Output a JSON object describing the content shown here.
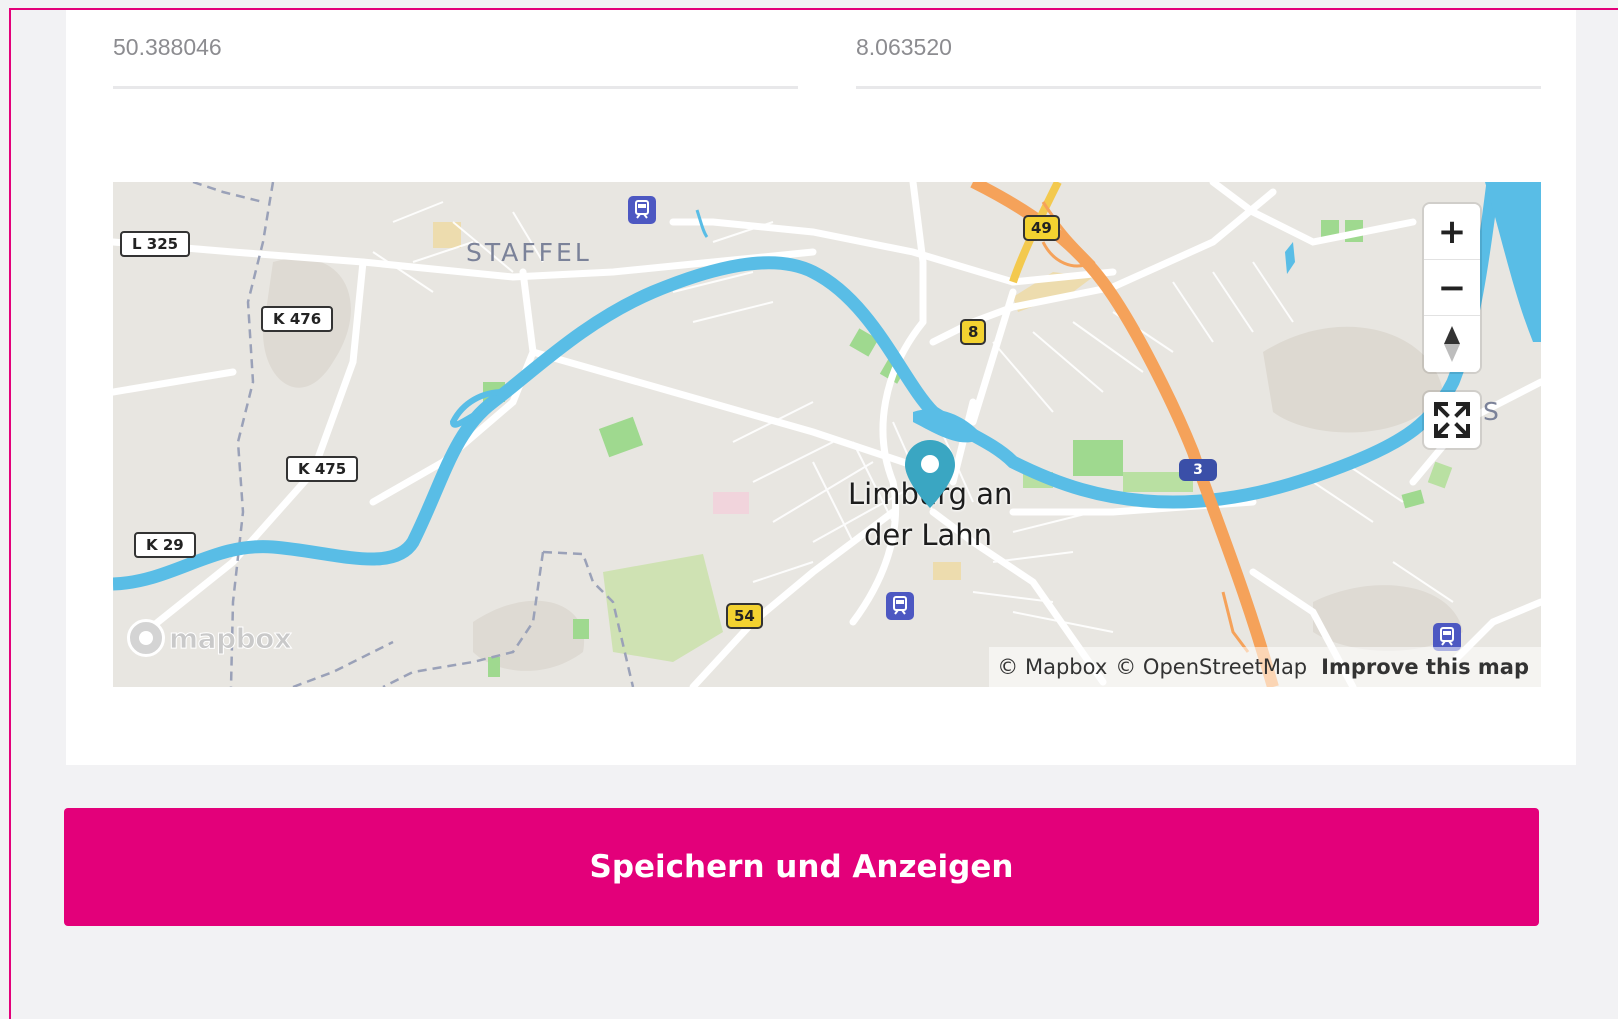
{
  "coordinates": {
    "latitude": "50.388046",
    "longitude": "8.063520"
  },
  "map": {
    "district_label": "STAFFEL",
    "city_label_line1": "Limburg an",
    "city_label_line2": "der Lahn",
    "edge_label": "S",
    "road_shields": {
      "l325": "L 325",
      "k476": "K 476",
      "k475": "K 475",
      "k29": "K 29",
      "b49": "49",
      "b8": "8",
      "b54": "54",
      "a3": "3"
    },
    "controls": {
      "zoom_in": "+",
      "zoom_out": "−"
    },
    "logo_text": "mapbox",
    "attribution": {
      "mapbox": "© Mapbox",
      "osm": "© OpenStreetMap",
      "improve": "Improve this map"
    },
    "colors": {
      "land": "#e8e6e1",
      "river": "#59bde6",
      "motorway": "#f5a25a",
      "marker": "#3aa6c2"
    }
  },
  "actions": {
    "save_label": "Speichern und Anzeigen"
  },
  "colors": {
    "accent": "#e3007a",
    "page_background": "#f2f2f4",
    "card_background": "#ffffff"
  }
}
